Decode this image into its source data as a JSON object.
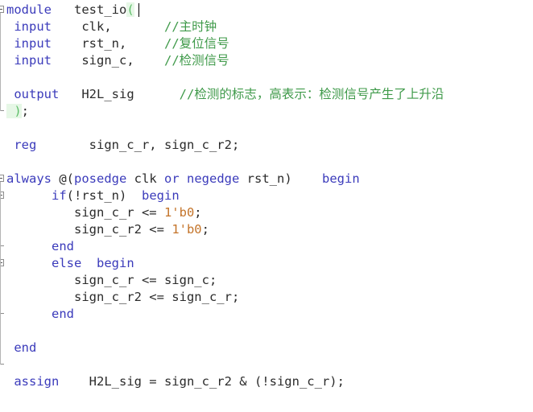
{
  "editor": {
    "language": "verilog",
    "background_color": "#ffffff",
    "keyword_color": "#3b3bbb",
    "identifier_color": "#2b2b2b",
    "comment_color": "#3f9a4a",
    "number_color": "#c4742a",
    "bracket_match_color": "#5fbf6a",
    "char_width": 11,
    "line_height": 21,
    "caret": {
      "line_index": 0,
      "column": 15,
      "after_text": "test_io"
    }
  },
  "lines": [
    {
      "index": 0,
      "fold": "open",
      "tokens": [
        {
          "t": "module",
          "c": "kw"
        },
        {
          "t": "   ",
          "c": "id"
        },
        {
          "t": "test_io",
          "c": "id"
        },
        {
          "t": "(",
          "c": "brk"
        }
      ],
      "plain": "module   test_io("
    },
    {
      "index": 1,
      "fold": "none",
      "tokens": [
        {
          "t": " input",
          "c": "kw"
        },
        {
          "t": "    clk,",
          "c": "id"
        },
        {
          "t": "       ",
          "c": "id"
        },
        {
          "t": "//主时钟",
          "c": "cmt"
        }
      ],
      "plain": " input    clk,       //主时钟"
    },
    {
      "index": 2,
      "fold": "none",
      "tokens": [
        {
          "t": " input",
          "c": "kw"
        },
        {
          "t": "    rst_n,",
          "c": "id"
        },
        {
          "t": "     ",
          "c": "id"
        },
        {
          "t": "//复位信号",
          "c": "cmt"
        }
      ],
      "plain": " input    rst_n,     //复位信号"
    },
    {
      "index": 3,
      "fold": "none",
      "tokens": [
        {
          "t": " input",
          "c": "kw"
        },
        {
          "t": "    sign_c,",
          "c": "id"
        },
        {
          "t": "    ",
          "c": "id"
        },
        {
          "t": "//检测信号",
          "c": "cmt"
        }
      ],
      "plain": " input    sign_c,    //检测信号"
    },
    {
      "index": 4,
      "fold": "none",
      "tokens": [],
      "plain": ""
    },
    {
      "index": 5,
      "fold": "none",
      "tokens": [
        {
          "t": " output",
          "c": "kw"
        },
        {
          "t": "   H2L_sig",
          "c": "id"
        },
        {
          "t": "      ",
          "c": "id"
        },
        {
          "t": "//检测的标志，高表示：检测信号产生了上升沿",
          "c": "cmt"
        }
      ],
      "plain": " output   H2L_sig      //检测的标志，高表示：检测信号产生了上升沿"
    },
    {
      "index": 6,
      "fold": "tick",
      "tokens": [
        {
          "t": " )",
          "c": "brk"
        },
        {
          "t": ";",
          "c": "op"
        }
      ],
      "plain": " );"
    },
    {
      "index": 7,
      "fold": "none",
      "tokens": [],
      "plain": ""
    },
    {
      "index": 8,
      "fold": "none",
      "tokens": [
        {
          "t": " reg",
          "c": "kw"
        },
        {
          "t": "       sign_c_r, sign_c_r2;",
          "c": "id"
        }
      ],
      "plain": " reg       sign_c_r, sign_c_r2;"
    },
    {
      "index": 9,
      "fold": "none",
      "tokens": [],
      "plain": ""
    },
    {
      "index": 10,
      "fold": "open",
      "tokens": [
        {
          "t": "always",
          "c": "kw"
        },
        {
          "t": " @(",
          "c": "op"
        },
        {
          "t": "posedge",
          "c": "kw"
        },
        {
          "t": " clk ",
          "c": "id"
        },
        {
          "t": "or",
          "c": "kw"
        },
        {
          "t": " ",
          "c": "id"
        },
        {
          "t": "negedge",
          "c": "kw"
        },
        {
          "t": " rst_n)",
          "c": "id"
        },
        {
          "t": "    ",
          "c": "id"
        },
        {
          "t": "begin",
          "c": "kw"
        }
      ],
      "plain": "always @(posedge clk or negedge rst_n)    begin"
    },
    {
      "index": 11,
      "fold": "open",
      "tokens": [
        {
          "t": "      ",
          "c": "id"
        },
        {
          "t": "if",
          "c": "kw"
        },
        {
          "t": "(!rst_n)  ",
          "c": "id"
        },
        {
          "t": "begin",
          "c": "kw"
        }
      ],
      "plain": "      if(!rst_n)  begin"
    },
    {
      "index": 12,
      "fold": "none",
      "tokens": [
        {
          "t": "         sign_c_r <= ",
          "c": "id"
        },
        {
          "t": "1'b0",
          "c": "num"
        },
        {
          "t": ";",
          "c": "op"
        }
      ],
      "plain": "         sign_c_r <= 1'b0;"
    },
    {
      "index": 13,
      "fold": "none",
      "tokens": [
        {
          "t": "         sign_c_r2 <= ",
          "c": "id"
        },
        {
          "t": "1'b0",
          "c": "num"
        },
        {
          "t": ";",
          "c": "op"
        }
      ],
      "plain": "         sign_c_r2 <= 1'b0;"
    },
    {
      "index": 14,
      "fold": "tick",
      "tokens": [
        {
          "t": "      ",
          "c": "id"
        },
        {
          "t": "end",
          "c": "kw"
        }
      ],
      "plain": "      end"
    },
    {
      "index": 15,
      "fold": "open",
      "tokens": [
        {
          "t": "      ",
          "c": "id"
        },
        {
          "t": "else",
          "c": "kw"
        },
        {
          "t": "  ",
          "c": "id"
        },
        {
          "t": "begin",
          "c": "kw"
        }
      ],
      "plain": "      else  begin"
    },
    {
      "index": 16,
      "fold": "none",
      "tokens": [
        {
          "t": "         sign_c_r <= sign_c;",
          "c": "id"
        }
      ],
      "plain": "         sign_c_r <= sign_c;"
    },
    {
      "index": 17,
      "fold": "none",
      "tokens": [
        {
          "t": "         sign_c_r2 <= sign_c_r;",
          "c": "id"
        }
      ],
      "plain": "         sign_c_r2 <= sign_c_r;"
    },
    {
      "index": 18,
      "fold": "tick",
      "tokens": [
        {
          "t": "      ",
          "c": "id"
        },
        {
          "t": "end",
          "c": "kw"
        }
      ],
      "plain": "      end"
    },
    {
      "index": 19,
      "fold": "none",
      "tokens": [],
      "plain": ""
    },
    {
      "index": 20,
      "fold": "none",
      "tokens": [
        {
          "t": " end",
          "c": "kw"
        }
      ],
      "plain": " end"
    },
    {
      "index": 21,
      "fold": "tick",
      "tokens": [],
      "plain": ""
    },
    {
      "index": 22,
      "fold": "none",
      "tokens": [
        {
          "t": " assign",
          "c": "kw"
        },
        {
          "t": "    H2L_sig = sign_c_r2 & (!sign_c_r);",
          "c": "id"
        }
      ],
      "plain": " assign    H2L_sig = sign_c_r2 & (!sign_c_r);"
    },
    {
      "index": 23,
      "fold": "none",
      "tokens": [],
      "plain": ""
    }
  ]
}
